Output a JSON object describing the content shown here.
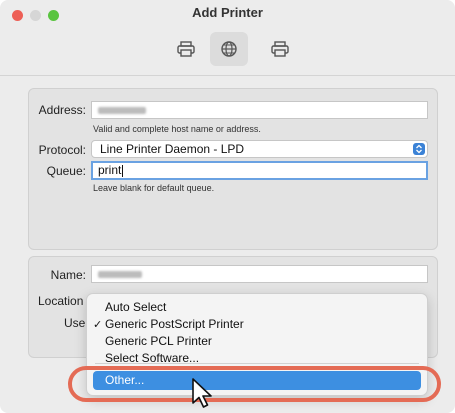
{
  "window": {
    "title": "Add Printer"
  },
  "toolbar": {
    "items": [
      {
        "icon": "printer-icon"
      },
      {
        "icon": "globe-icon"
      },
      {
        "icon": "printer-share-icon"
      }
    ]
  },
  "form": {
    "address_label": "Address:",
    "address_hint": "Valid and complete host name or address.",
    "protocol_label": "Protocol:",
    "protocol_value": "Line Printer Daemon - LPD",
    "queue_label": "Queue:",
    "queue_value": "print",
    "queue_hint": "Leave blank for default queue.",
    "name_label": "Name:",
    "location_label": "Location",
    "use_label": "Use"
  },
  "menu": {
    "items": [
      "Auto Select",
      "Generic PostScript Printer",
      "Generic PCL Printer",
      "Select Software...",
      "Other..."
    ],
    "checked": "Generic PostScript Printer",
    "highlighted": "Other..."
  },
  "colors": {
    "accent": "#3d8fe1",
    "highlight_ring": "#e46b55"
  }
}
